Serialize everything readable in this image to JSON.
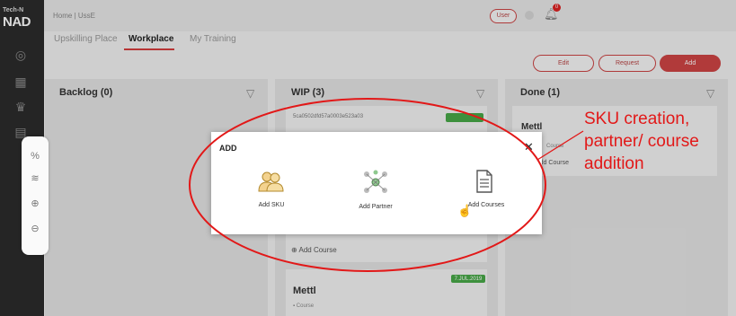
{
  "logo": {
    "small": "Tech-N",
    "big": "NAD"
  },
  "header": {
    "breadcrumb": "Home | UssE",
    "user_pill": "User",
    "notif_badge": "0"
  },
  "tabs": [
    "Upskilling Place",
    "Workplace",
    "My Training"
  ],
  "actions": {
    "edit": "Edit",
    "request": "Request",
    "add": "Add"
  },
  "columns": {
    "backlog": {
      "title": "Backlog (0)"
    },
    "wip": {
      "title": "WIP (3)",
      "card_id": "5ca0502dfd57a0003e523a03",
      "bottom_date": "7.JUL.2019",
      "bottom_title": "Mettl",
      "bottom_sub": "Course",
      "add_course": "Add Course"
    },
    "done": {
      "title": "Done (1)",
      "card_title": "Mettl",
      "card_sub": "Course",
      "add_course": "Add Course"
    }
  },
  "modal": {
    "title": "ADD",
    "options": [
      {
        "label": "Add SKU",
        "icon": "users-icon"
      },
      {
        "label": "Add Partner",
        "icon": "partner-network-icon"
      },
      {
        "label": "Add Courses",
        "icon": "document-icon"
      }
    ]
  },
  "annotation": {
    "line1": "SKU creation,",
    "line2": "partner/ course",
    "line3": "addition"
  },
  "colors": {
    "accent": "#cf4444",
    "badge": "#48a848",
    "annotation": "#e21818"
  }
}
